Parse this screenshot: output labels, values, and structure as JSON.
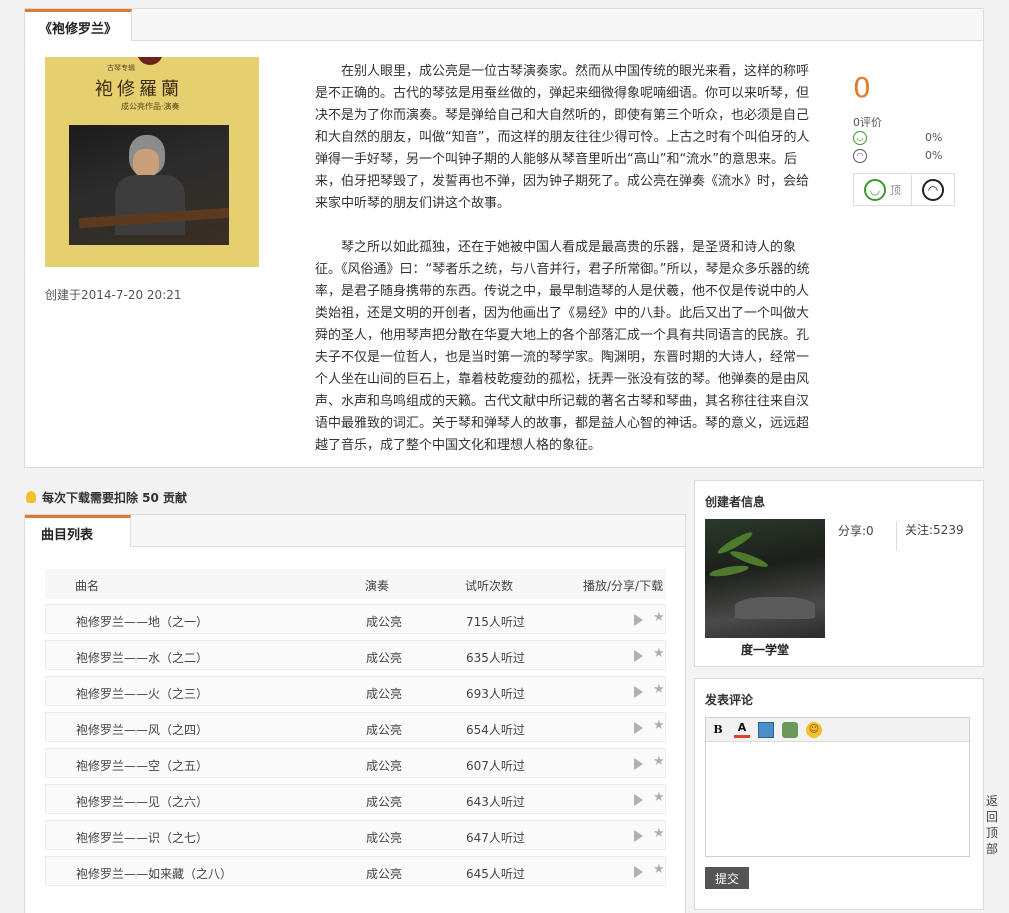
{
  "album": {
    "tab_title": "《袍修罗兰》",
    "cover": {
      "title": "袍修羅蘭",
      "small_text": "古琴专辑",
      "subtitle": "成公亮作品·演奏"
    },
    "created": "创建于2014-7-20 20:21",
    "description": [
      "在别人眼里，成公亮是一位古琴演奏家。然而从中国传统的眼光来看，这样的称呼是不正确的。古代的琴弦是用蚕丝做的，弹起来细微得象呢喃细语。你可以来听琴，但决不是为了你而演奏。琴是弹给自己和大自然听的，即使有第三个听众，也必须是自己和大自然的朋友，叫做“知音”，而这样的朋友往往少得可怜。上古之时有个叫伯牙的人弹得一手好琴，另一个叫钟子期的人能够从琴音里听出“高山”和“流水”的意思来。后来，伯牙把琴毁了，发誓再也不弹，因为钟子期死了。成公亮在弹奏《流水》时，会给来家中听琴的朋友们讲这个故事。",
      "琴之所以如此孤独，还在于她被中国人看成是最高贵的乐器，是圣贤和诗人的象征。《风俗通》曰：“琴者乐之统，与八音并行，君子所常御。”所以，琴是众多乐器的统率，是君子随身携带的东西。传说之中，最早制造琴的人是伏羲，他不仅是传说中的人类始祖，还是文明的开创者，因为他画出了《易经》中的八卦。此后又出了一个叫做大舜的圣人，他用琴声把分散在华夏大地上的各个部落汇成一个具有共同语言的民族。孔夫子不仅是一位哲人，也是当时第一流的琴学家。陶渊明，东晋时期的大诗人，经常一个人坐在山间的巨石上，靠着枝乾瘦劲的孤松，抚弄一张没有弦的琴。他弹奏的是由风声、水声和鸟鸣组成的天籁。古代文献中所记载的著名古琴和琴曲，其名称往往来自汉语中最雅致的词汇。关于琴和弹琴人的故事，都是益人心智的神话。琴的意义，远远超越了音乐，成了整个中国文化和理想人格的象征。"
    ],
    "rating": {
      "score": "0",
      "count_label": "0评价",
      "positive_pct": "0%",
      "negative_pct": "0%",
      "up_label": "顶"
    }
  },
  "notice": "每次下载需要扣除 50 贡献",
  "tracks": {
    "tab_title": "曲目列表",
    "headers": {
      "name": "曲名",
      "artist": "演奏",
      "plays": "试听次数",
      "ops": "播放/分享/下载"
    },
    "rows": [
      {
        "name": "袍修罗兰——地（之一）",
        "artist": "成公亮",
        "plays": "715人听过"
      },
      {
        "name": "袍修罗兰——水（之二）",
        "artist": "成公亮",
        "plays": "635人听过"
      },
      {
        "name": "袍修罗兰——火（之三）",
        "artist": "成公亮",
        "plays": "693人听过"
      },
      {
        "name": "袍修罗兰——风（之四）",
        "artist": "成公亮",
        "plays": "654人听过"
      },
      {
        "name": "袍修罗兰——空（之五）",
        "artist": "成公亮",
        "plays": "607人听过"
      },
      {
        "name": "袍修罗兰——见（之六）",
        "artist": "成公亮",
        "plays": "643人听过"
      },
      {
        "name": "袍修罗兰——识（之七）",
        "artist": "成公亮",
        "plays": "647人听过"
      },
      {
        "name": "袍修罗兰——如来藏（之八）",
        "artist": "成公亮",
        "plays": "645人听过"
      }
    ]
  },
  "creator": {
    "heading": "创建者信息",
    "name": "度一学堂",
    "share": "分享:0",
    "follow": "关注:5239"
  },
  "comment": {
    "heading": "发表评论",
    "submit_label": "提交"
  },
  "back_to_top": "返回顶部",
  "colors": {
    "accent": "#e07a2e",
    "score": "#e47a24"
  },
  "icons": [
    "bulb-icon",
    "smile-icon",
    "frown-icon",
    "play-icon",
    "star-icon",
    "bold-icon",
    "font-color-icon",
    "image-icon",
    "media-icon",
    "emoji-icon"
  ]
}
